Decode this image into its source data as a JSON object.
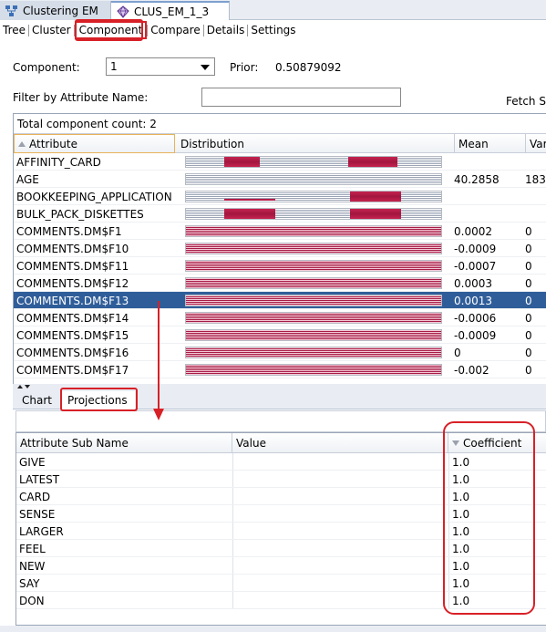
{
  "doc_tabs": [
    {
      "label": "Clustering EM"
    },
    {
      "label": "CLUS_EM_1_3"
    }
  ],
  "sub_tabs": [
    "Tree",
    "Cluster",
    "Component",
    "Compare",
    "Details",
    "Settings"
  ],
  "component_label": "Component:",
  "component_value": "1",
  "prior_label": "Prior:",
  "prior_value": "0.50879092",
  "filter_label": "Filter by Attribute Name:",
  "filter_value": "",
  "fetch_label": "Fetch S",
  "upper_grid": {
    "count_text": "Total component count: 2",
    "headers": [
      "Attribute",
      "Distribution",
      "Mean",
      "Var"
    ],
    "rows": [
      {
        "attr": "AFFINITY_CARD",
        "mean": "",
        "var": "",
        "bars": [
          0.15,
          0.29,
          0.63,
          0.82
        ],
        "full": false
      },
      {
        "attr": "AGE",
        "mean": "40.2858",
        "var": "183.",
        "bars": [],
        "full": false
      },
      {
        "attr": "BOOKKEEPING_APPLICATION",
        "mean": "",
        "var": "",
        "bars": [
          0.15,
          0.35,
          0.64,
          0.84
        ],
        "full": false
      },
      {
        "attr": "BULK_PACK_DISKETTES",
        "mean": "",
        "var": "",
        "bars": [
          0.15,
          0.35,
          0.64,
          0.84
        ],
        "full": false
      },
      {
        "attr": "COMMENTS.DM$F1",
        "mean": "0.0002",
        "var": "0",
        "bars": [],
        "full": true
      },
      {
        "attr": "COMMENTS.DM$F10",
        "mean": "-0.0009",
        "var": "0",
        "bars": [],
        "full": true
      },
      {
        "attr": "COMMENTS.DM$F11",
        "mean": "-0.0007",
        "var": "0",
        "bars": [],
        "full": true
      },
      {
        "attr": "COMMENTS.DM$F12",
        "mean": "0.0003",
        "var": "0",
        "bars": [],
        "full": true
      },
      {
        "attr": "COMMENTS.DM$F13",
        "mean": "0.0013",
        "var": "0",
        "bars": [],
        "full": true,
        "selected": true
      },
      {
        "attr": "COMMENTS.DM$F14",
        "mean": "-0.0006",
        "var": "0",
        "bars": [],
        "full": true
      },
      {
        "attr": "COMMENTS.DM$F15",
        "mean": "-0.0009",
        "var": "0",
        "bars": [],
        "full": true
      },
      {
        "attr": "COMMENTS.DM$F16",
        "mean": "0",
        "var": "0",
        "bars": [],
        "full": true
      },
      {
        "attr": "COMMENTS.DM$F17",
        "mean": "-0.002",
        "var": "0",
        "bars": [],
        "full": true
      }
    ]
  },
  "lower_tabs": [
    "Chart",
    "Projections"
  ],
  "lower_grid": {
    "headers": [
      "Attribute Sub Name",
      "Value",
      "Coefficient"
    ],
    "rows": [
      {
        "name": "GIVE",
        "value": "",
        "coef": "1.0"
      },
      {
        "name": "LATEST",
        "value": "",
        "coef": "1.0"
      },
      {
        "name": "CARD",
        "value": "",
        "coef": "1.0"
      },
      {
        "name": "SENSE",
        "value": "",
        "coef": "1.0"
      },
      {
        "name": "LARGER",
        "value": "",
        "coef": "1.0"
      },
      {
        "name": "FEEL",
        "value": "",
        "coef": "1.0"
      },
      {
        "name": "NEW",
        "value": "",
        "coef": "1.0"
      },
      {
        "name": "SAY",
        "value": "",
        "coef": "1.0"
      },
      {
        "name": "DON",
        "value": "",
        "coef": "1.0"
      }
    ]
  },
  "colors": {
    "highlight": "#d82027",
    "selection": "#2f5d99",
    "bar_fill": "#a71c46"
  }
}
